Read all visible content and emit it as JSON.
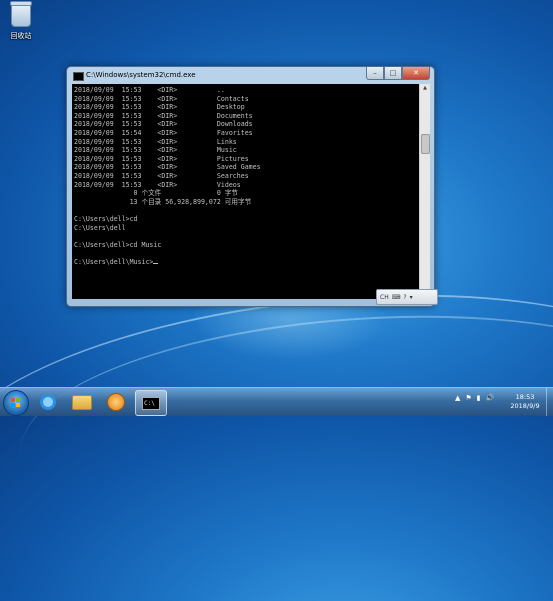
{
  "desktop": {
    "recycle_bin_label": "回收站"
  },
  "window": {
    "title": "C:\\Windows\\system32\\cmd.exe",
    "controls": {
      "minimize": "–",
      "maximize": "□",
      "close": "✕"
    }
  },
  "console": {
    "lines": [
      "2018/09/09  15:53    <DIR>          ..",
      "2018/09/09  15:53    <DIR>          Contacts",
      "2018/09/09  15:53    <DIR>          Desktop",
      "2018/09/09  15:53    <DIR>          Documents",
      "2018/09/09  15:53    <DIR>          Downloads",
      "2018/09/09  15:54    <DIR>          Favorites",
      "2018/09/09  15:53    <DIR>          Links",
      "2018/09/09  15:53    <DIR>          Music",
      "2018/09/09  15:53    <DIR>          Pictures",
      "2018/09/09  15:53    <DIR>          Saved Games",
      "2018/09/09  15:53    <DIR>          Searches",
      "2018/09/09  15:53    <DIR>          Videos",
      "               0 个文件              0 字节",
      "              13 个目录 56,928,899,072 可用字节",
      "",
      "C:\\Users\\dell>cd",
      "C:\\Users\\dell",
      "",
      "C:\\Users\\dell>cd Music",
      "",
      "C:\\Users\\dell\\Music>"
    ]
  },
  "language_bar": {
    "items": [
      "CH",
      "⌨",
      "?",
      "▾"
    ]
  },
  "taskbar": {
    "buttons": [
      {
        "name": "internet-explorer",
        "active": false
      },
      {
        "name": "windows-explorer",
        "active": false
      },
      {
        "name": "media-player",
        "active": false
      },
      {
        "name": "cmd",
        "active": true,
        "label": "C:\\"
      }
    ],
    "tray_icons": [
      "▲",
      "⚑",
      "▮",
      "🔊"
    ],
    "clock": {
      "time": "18:53",
      "date": "2018/9/9"
    }
  },
  "colors": {
    "console_bg": "#000000",
    "console_fg": "#c0c0c0",
    "accent": "#1f78c8"
  }
}
